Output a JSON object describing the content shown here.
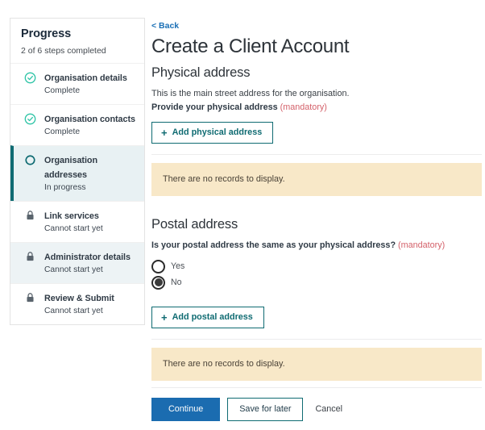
{
  "sidebar": {
    "title": "Progress",
    "subtitle": "2 of 6 steps completed",
    "steps": [
      {
        "label": "Organisation details",
        "status": "Complete",
        "icon": "check-circle-icon",
        "state": "complete"
      },
      {
        "label": "Organisation contacts",
        "status": "Complete",
        "icon": "check-circle-icon",
        "state": "complete"
      },
      {
        "label": "Organisation addresses",
        "status": "In progress",
        "icon": "circle-icon",
        "state": "active"
      },
      {
        "label": "Link services",
        "status": "Cannot start yet",
        "icon": "lock-icon",
        "state": "locked"
      },
      {
        "label": "Administrator details",
        "status": "Cannot start yet",
        "icon": "lock-icon",
        "state": "locked"
      },
      {
        "label": "Review & Submit",
        "status": "Cannot start yet",
        "icon": "lock-icon",
        "state": "locked"
      }
    ]
  },
  "main": {
    "back_label": "< Back",
    "page_title": "Create a Client Account",
    "physical": {
      "section_title": "Physical address",
      "description": "This is the main street address for the organisation.",
      "field_label": "Provide your physical address",
      "mandatory_text": "(mandatory)",
      "add_button_label": "Add physical address",
      "empty_message": "There are no records to display."
    },
    "postal": {
      "section_title": "Postal address",
      "question": "Is your postal address the same as your physical address?",
      "mandatory_text": "(mandatory)",
      "options": [
        {
          "label": "Yes",
          "selected": false
        },
        {
          "label": "No",
          "selected": true
        }
      ],
      "add_button_label": "Add postal address",
      "empty_message": "There are no records to display."
    }
  },
  "footer": {
    "continue_label": "Continue",
    "save_label": "Save for later",
    "cancel_label": "Cancel"
  },
  "colors": {
    "teal": "#0f6b72",
    "blue": "#1b6cb0",
    "link_blue": "#1a6fb5",
    "mandatory_red": "#d4616a",
    "banner_bg": "#f8e8c8",
    "active_row_bg": "#e8f1f3",
    "complete_green": "#2ec4a6"
  }
}
